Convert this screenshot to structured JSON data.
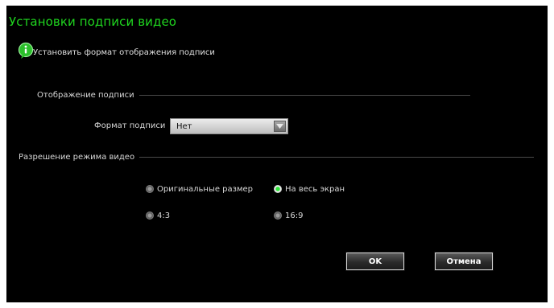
{
  "dialog": {
    "title": "Установки подписи видео",
    "subtitle": "Установить формат отображения подписи"
  },
  "caption_display": {
    "section_label": "Отображение подписи",
    "format_label": "Формат подписи",
    "format_value": "Нет"
  },
  "video_mode": {
    "section_label": "Разрешение режима видео",
    "options": [
      {
        "label": "Оригинальные размер",
        "checked": false
      },
      {
        "label": "На весь экран",
        "checked": true
      },
      {
        "label": "4:3",
        "checked": false
      },
      {
        "label": "16:9",
        "checked": false
      }
    ]
  },
  "buttons": {
    "ok": "OK",
    "cancel": "Отмена"
  },
  "icons": {
    "info": "info-icon",
    "dropdown": "chevron-down-icon"
  },
  "colors": {
    "title_green": "#1fd61f",
    "background": "#000000",
    "radio_selected": "#2fe63a"
  }
}
